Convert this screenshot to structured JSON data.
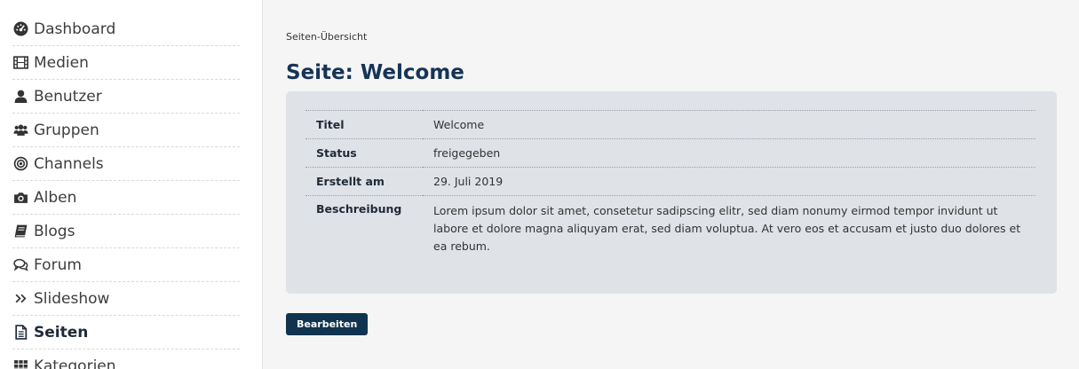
{
  "sidebar": {
    "items": [
      {
        "label": "Dashboard",
        "icon": "dashboard-icon"
      },
      {
        "label": "Medien",
        "icon": "film-icon"
      },
      {
        "label": "Benutzer",
        "icon": "user-icon"
      },
      {
        "label": "Gruppen",
        "icon": "users-icon"
      },
      {
        "label": "Channels",
        "icon": "channel-icon"
      },
      {
        "label": "Alben",
        "icon": "camera-icon"
      },
      {
        "label": "Blogs",
        "icon": "book-icon"
      },
      {
        "label": "Forum",
        "icon": "comments-icon"
      },
      {
        "label": "Slideshow",
        "icon": "double-chevron-right-icon"
      },
      {
        "label": "Seiten",
        "icon": "file-text-icon",
        "active": true
      },
      {
        "label": "Kategorien",
        "icon": "grid-icon"
      }
    ]
  },
  "main": {
    "breadcrumb": "Seiten-Übersicht",
    "title": "Seite: Welcome",
    "details": {
      "title_label": "Titel",
      "title_value": "Welcome",
      "status_label": "Status",
      "status_value": "freigegeben",
      "created_label": "Erstellt am",
      "created_value": "29. Juli 2019",
      "description_label": "Beschreibung",
      "description_value": "Lorem ipsum dolor sit amet, consetetur sadipscing elitr, sed diam nonumy eirmod tempor invidunt ut labore et dolore magna aliquyam erat, sed diam voluptua. At vero eos et accusam et justo duo dolores et ea rebum."
    },
    "edit_button_label": "Bearbeiten"
  },
  "colors": {
    "title": "#163457",
    "button": "#10344f",
    "card": "#dfe2e6",
    "background": "#f5f5f5"
  }
}
